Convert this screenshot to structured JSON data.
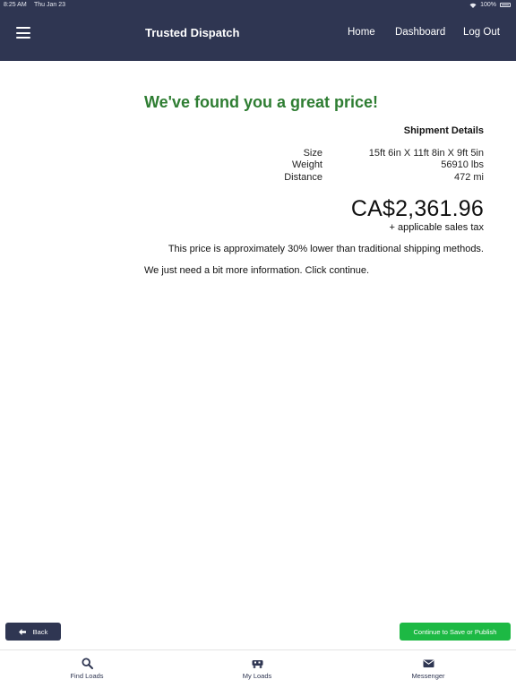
{
  "status_bar": {
    "time": "8:25 AM",
    "date": "Thu Jan 23",
    "battery": "100%"
  },
  "header": {
    "title": "Trusted Dispatch",
    "nav": [
      {
        "label": "Home"
      },
      {
        "label": "Dashboard"
      },
      {
        "label": "Log Out"
      }
    ]
  },
  "main": {
    "headline": "We've found you a great price!",
    "section_title": "Shipment Details",
    "details": [
      {
        "label": "Size",
        "value": "15ft 6in X 11ft 8in X 9ft 5in"
      },
      {
        "label": "Weight",
        "value": "56910 lbs"
      },
      {
        "label": "Distance",
        "value": "472 mi"
      }
    ],
    "price": "CA$2,361.96",
    "tax_note": "+ applicable sales tax",
    "savings_note": "This price is approximately 30% lower than traditional shipping methods.",
    "info_note": "We just need a bit more information. Click continue."
  },
  "actions": {
    "back_label": "Back",
    "continue_label": "Continue to Save or Publish"
  },
  "tabbar": {
    "tabs": [
      {
        "label": "Find Loads",
        "icon": "search-icon"
      },
      {
        "label": "My Loads",
        "icon": "truck-icon"
      },
      {
        "label": "Messenger",
        "icon": "mail-icon"
      }
    ]
  },
  "colors": {
    "header_bg": "#2f3652",
    "headline": "#2e7d32",
    "continue_bg": "#1db944"
  }
}
